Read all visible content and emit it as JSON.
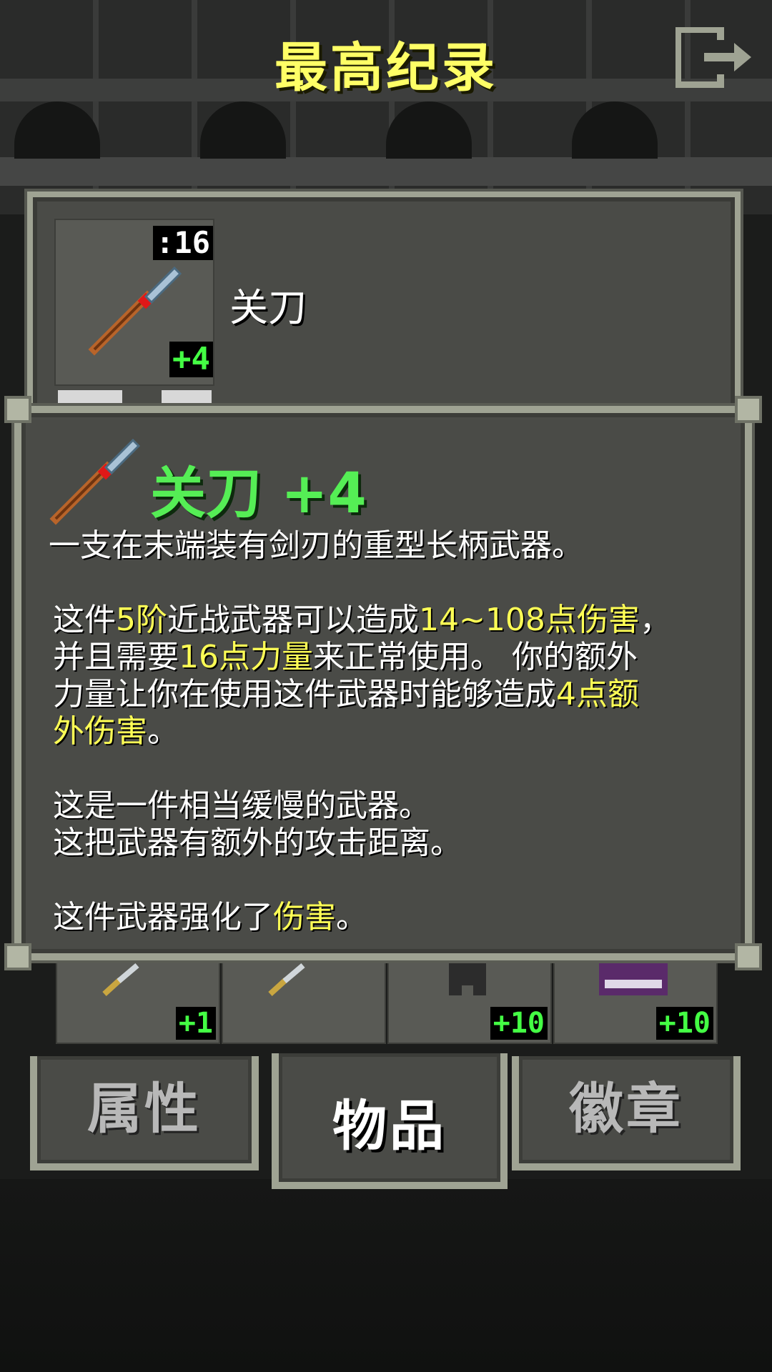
{
  "header": {
    "title": "最高纪录"
  },
  "top_item": {
    "name": "关刀",
    "strength_req": ":16",
    "level": "+4"
  },
  "info": {
    "title": "关刀 +4",
    "line1": "一支在末端装有剑刃的重型长柄武器。",
    "p2_a": "这件",
    "p2_b": "5阶",
    "p2_c": "近战武器可以造成",
    "p2_d": "14~108点伤害",
    "p2_e": "，",
    "p2_f": "并且需要",
    "p2_g": "16点力量",
    "p2_h": "来正常使用。 你的额外",
    "p2_i": "力量让你在使用这件武器时能够造成",
    "p2_j": "4点额",
    "p2_k": "外伤害",
    "p2_l": "。",
    "p3_a": "这是一件相当缓慢的武器。",
    "p3_b": "这把武器有额外的攻击距离。",
    "p4_a": "这件武器强化了",
    "p4_b": "伤害",
    "p4_c": "。"
  },
  "item_row": [
    {
      "icon": "dagger-icon",
      "level": "+1"
    },
    {
      "icon": "dagger-icon",
      "level": ""
    },
    {
      "icon": "armor-icon",
      "level": "+10"
    },
    {
      "icon": "spellbook-icon",
      "level": "+10"
    }
  ],
  "tabs": {
    "attributes": "属性",
    "items": "物品",
    "badges": "徽章"
  },
  "colors": {
    "title": "#ffff66",
    "highlight": "#ffff55",
    "upgrade": "#44ff44",
    "panel": "#4a4b47",
    "border": "#9fa393"
  }
}
